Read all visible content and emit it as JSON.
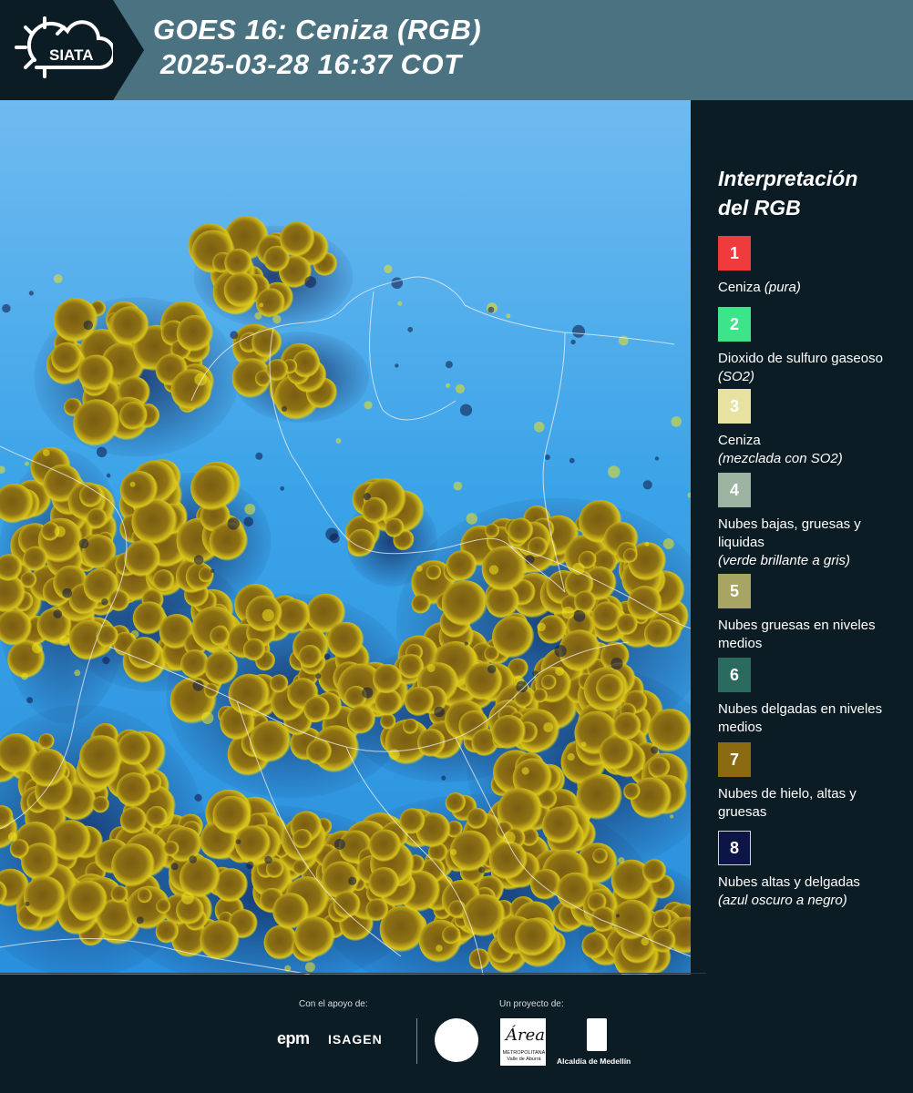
{
  "header": {
    "logo_text": "SIATA",
    "title_line1": "GOES 16: Ceniza (RGB)",
    "title_line2": "2025-03-28 16:37 COT",
    "colors": {
      "bar": "#4a7280",
      "logo_bg": "#0c1c25"
    }
  },
  "legend": {
    "title_line1": "Interpretación",
    "title_line2": "del RGB",
    "items": [
      {
        "number": "1",
        "color": "#ef3b3b",
        "label": "Ceniza",
        "note": "(pura)"
      },
      {
        "number": "2",
        "color": "#3de58a",
        "label": "Dioxido de sulfuro gaseoso",
        "note": "(SO2)"
      },
      {
        "number": "3",
        "color": "#e7e2a0",
        "label": "Ceniza",
        "note": "(mezclada con SO2)"
      },
      {
        "number": "4",
        "color": "#9cb3a2",
        "label": "Nubes bajas, gruesas y liquidas",
        "note": "(verde brillante a gris)"
      },
      {
        "number": "5",
        "color": "#a8a464",
        "label": "Nubes gruesas en niveles medios",
        "note": ""
      },
      {
        "number": "6",
        "color": "#2b6a5e",
        "label": "Nubes delgadas en niveles medios",
        "note": ""
      },
      {
        "number": "7",
        "color": "#8b6b12",
        "label": "Nubes de hielo, altas y gruesas",
        "note": ""
      },
      {
        "number": "8",
        "color": "#0d1546",
        "label": "Nubes altas y delgadas",
        "note": "(azul oscuro a negro)"
      }
    ]
  },
  "footer": {
    "support_label": "Con el apoyo de:",
    "project_label": "Un proyecto de:",
    "epm": "epm",
    "isagen": "ISAGEN",
    "amva_script": "Área",
    "amva_small": "METROPOLITANA Valle de Aburrá",
    "alcaldia": "Alcaldía de Medellín"
  },
  "map": {
    "background_color": "#3aa3e8",
    "cloud_color": "#8b6b12",
    "cloud_edge_color": "#f2e11c"
  }
}
